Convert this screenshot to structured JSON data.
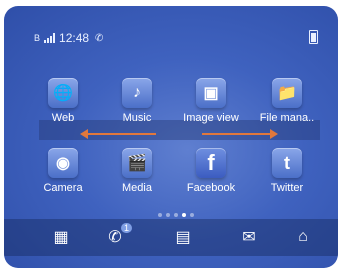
{
  "status": {
    "network_type": "B",
    "time": "12:48"
  },
  "apps": [
    {
      "label": "Web",
      "icon": "globe-icon"
    },
    {
      "label": "Music",
      "icon": "music-icon"
    },
    {
      "label": "Image view",
      "icon": "image-view-icon"
    },
    {
      "label": "File mana..",
      "icon": "folder-icon"
    },
    {
      "label": "Camera",
      "icon": "camera-icon"
    },
    {
      "label": "Media",
      "icon": "media-icon"
    },
    {
      "label": "Facebook",
      "icon": "facebook-icon"
    },
    {
      "label": "Twitter",
      "icon": "twitter-icon"
    }
  ],
  "page_indicator": {
    "total": 5,
    "active": 4
  },
  "dock": [
    {
      "icon": "app-grid-icon"
    },
    {
      "icon": "phone-icon",
      "badge": "1"
    },
    {
      "icon": "contacts-icon"
    },
    {
      "icon": "messages-icon"
    },
    {
      "icon": "home-icon"
    }
  ],
  "colors": {
    "accent_arrow": "#e1783c",
    "background": "#3f62bf"
  }
}
